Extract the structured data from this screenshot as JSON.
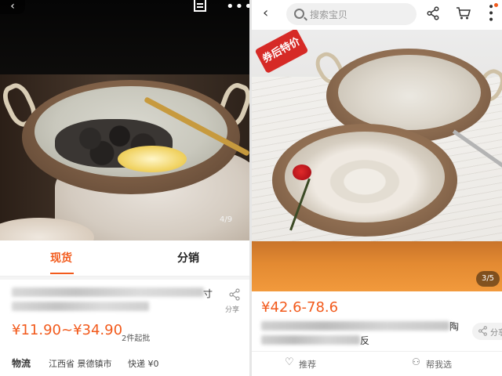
{
  "left": {
    "image_counter": "4/9",
    "tabs": [
      {
        "label": "现货",
        "active": true
      },
      {
        "label": "分销",
        "active": false
      }
    ],
    "product": {
      "title_tail": "寸",
      "price": "¥11.90~¥34.90",
      "min_order": "2件起批",
      "share_label": "分享"
    },
    "logistics": {
      "label": "物流",
      "origin": "江西省 景德镇市",
      "shipping": "快递 ¥0"
    }
  },
  "right": {
    "search": {
      "placeholder": "搜索宝贝"
    },
    "tag_text": "券后特价",
    "image_counter": "3/5",
    "price": "¥42.6-78.6",
    "title_tail_1": "陶",
    "title_tail_2": "反",
    "share_chip_label": "分享",
    "bottom": {
      "recommend": "推荐",
      "help_choose": "帮我选"
    }
  },
  "colors": {
    "accent": "#f25a1c",
    "banner": "#e38a32"
  }
}
